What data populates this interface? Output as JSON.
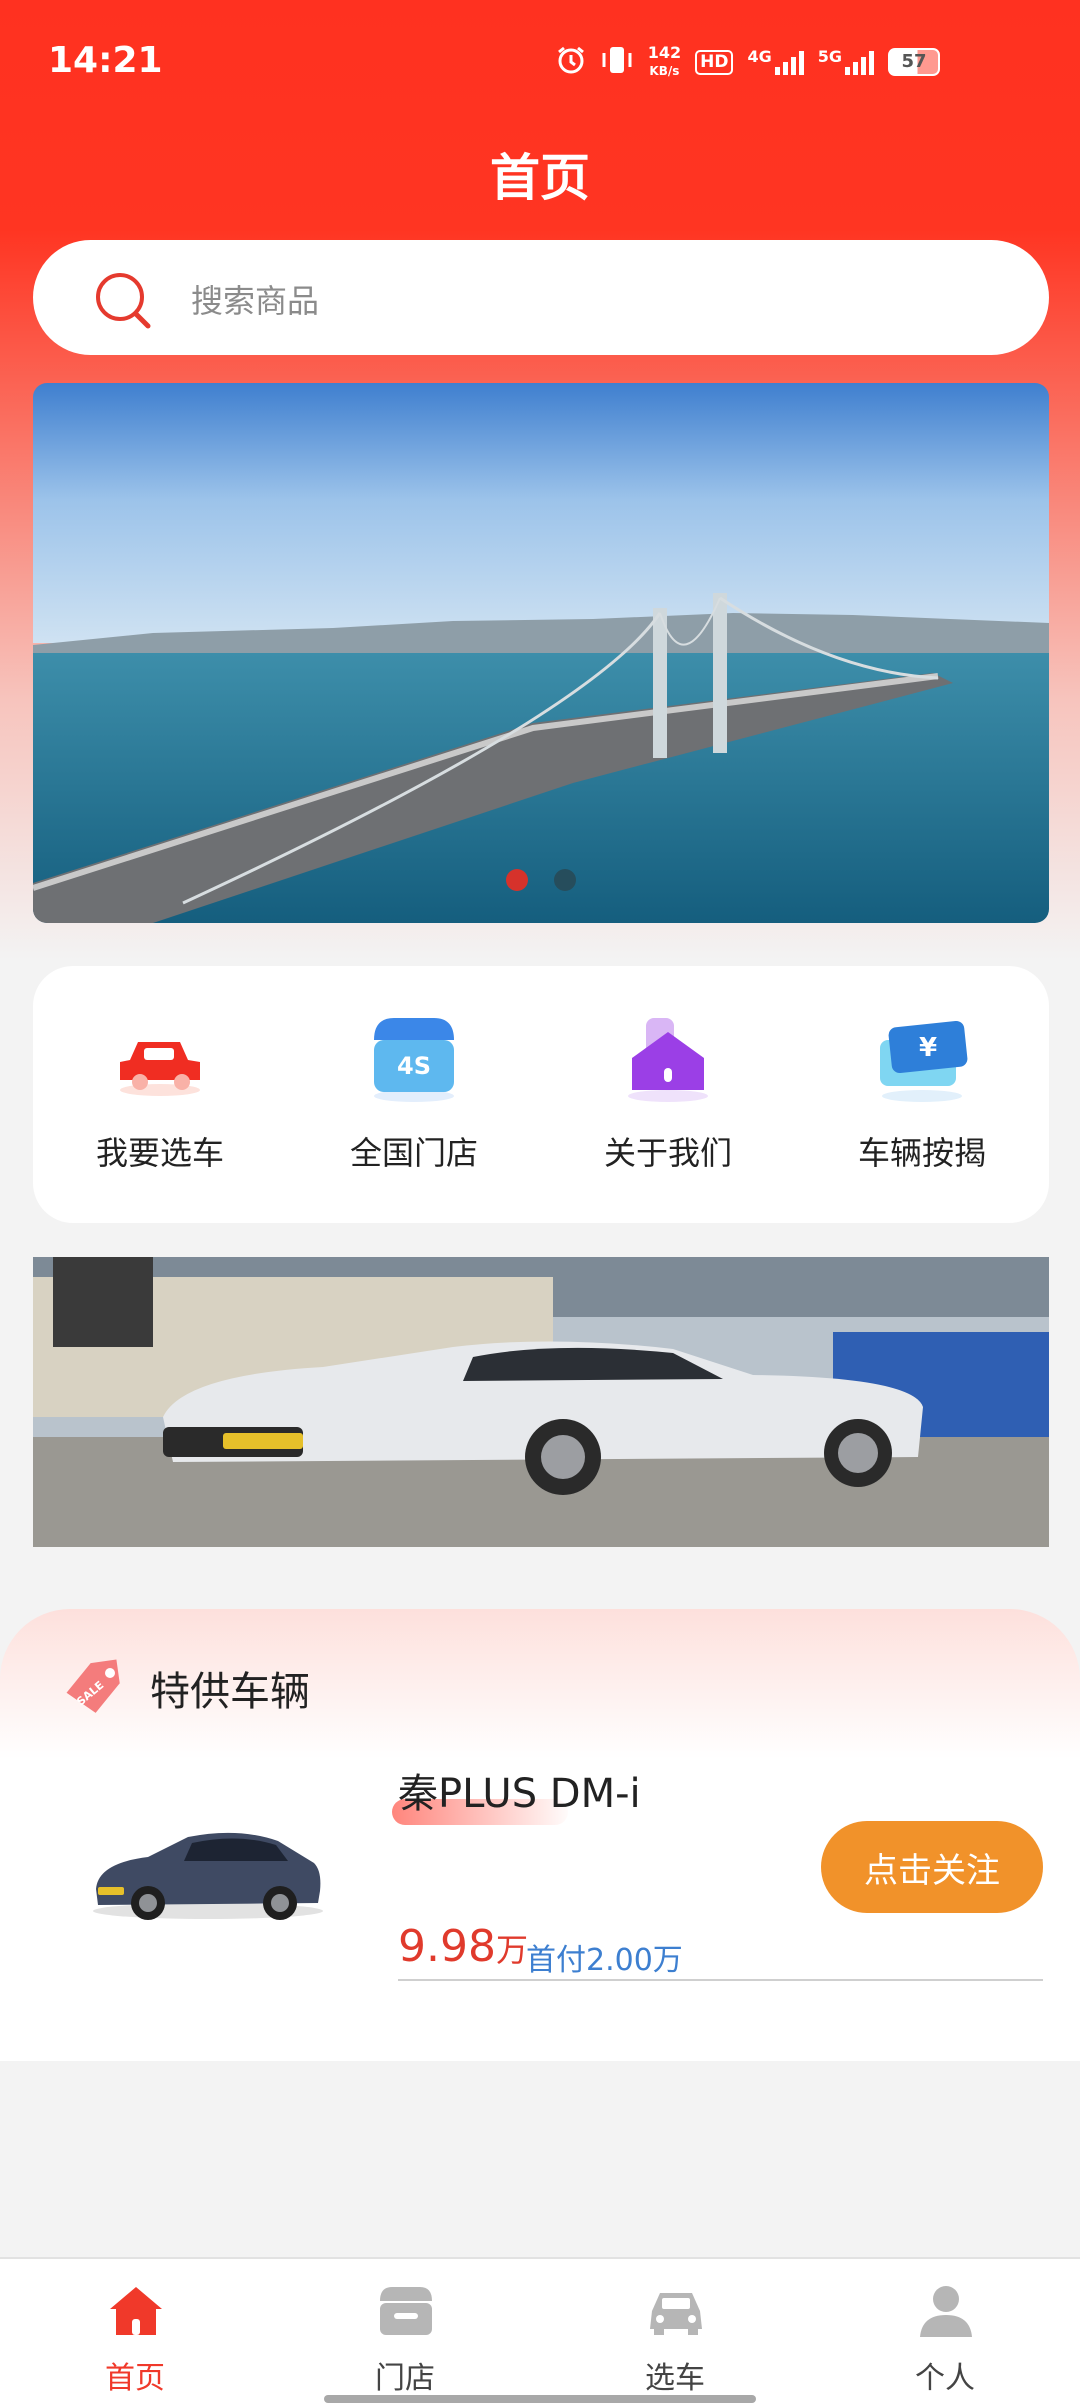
{
  "status_bar": {
    "time": "14:21",
    "net_speed_value": "142",
    "net_speed_unit": "KB/s",
    "hd_label": "HD",
    "network_4g": "4G",
    "network_5g": "5G",
    "battery": "57",
    "icons": [
      "alarm-icon",
      "vibrate-icon",
      "hd-voice-icon",
      "signal-4g-icon",
      "signal-5g-icon",
      "battery-icon"
    ]
  },
  "header": {
    "title": "首页"
  },
  "search": {
    "placeholder": "搜索商品"
  },
  "banner": {
    "slide_count": 2,
    "active_index": 0
  },
  "quick_menu": [
    {
      "label": "我要选车",
      "icon": "red-car-icon"
    },
    {
      "label": "全国门店",
      "icon": "4s-store-icon"
    },
    {
      "label": "关于我们",
      "icon": "purple-house-icon"
    },
    {
      "label": "车辆按揭",
      "icon": "yuan-card-icon"
    }
  ],
  "special": {
    "title": "特供车辆",
    "sale_tag": "SALE",
    "car": {
      "name": "秦PLUS DM-i",
      "price": "9.98",
      "price_unit": "万",
      "down_payment": "首付2.00万",
      "follow_label": "点击关注"
    }
  },
  "bottom_nav": [
    {
      "label": "首页",
      "icon": "home-icon",
      "active": true
    },
    {
      "label": "门店",
      "icon": "store-icon",
      "active": false
    },
    {
      "label": "选车",
      "icon": "car-icon",
      "active": false
    },
    {
      "label": "个人",
      "icon": "person-icon",
      "active": false
    }
  ],
  "colors": {
    "brand_red": "#ff3120",
    "accent_orange": "#f1922a",
    "price_red": "#e03a2c",
    "link_blue": "#3d7fd0"
  }
}
